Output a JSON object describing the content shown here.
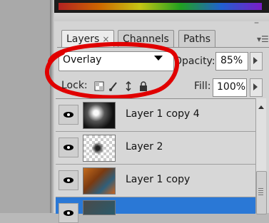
{
  "tabs": {
    "layers": "Layers",
    "layers_close": "×",
    "channels": "Channels",
    "paths": "Paths"
  },
  "panel": {
    "window_control": "–",
    "menu_icon": "menu-icon"
  },
  "blend_mode": {
    "value": "Overlay"
  },
  "opacity": {
    "label": "Opacity:",
    "value": "85%"
  },
  "lock": {
    "label": "Lock:",
    "icons": [
      "lock-transparent-icon",
      "lock-brush-icon",
      "lock-move-icon",
      "lock-all-icon"
    ]
  },
  "fill": {
    "label": "Fill:",
    "value": "100%"
  },
  "layers": [
    {
      "name": "Layer 1 copy 4",
      "visible": true
    },
    {
      "name": "Layer 2",
      "visible": true
    },
    {
      "name": "Layer 1 copy",
      "visible": true
    },
    {
      "name": "",
      "visible": true
    }
  ],
  "annotation": {
    "color": "#e00000"
  }
}
